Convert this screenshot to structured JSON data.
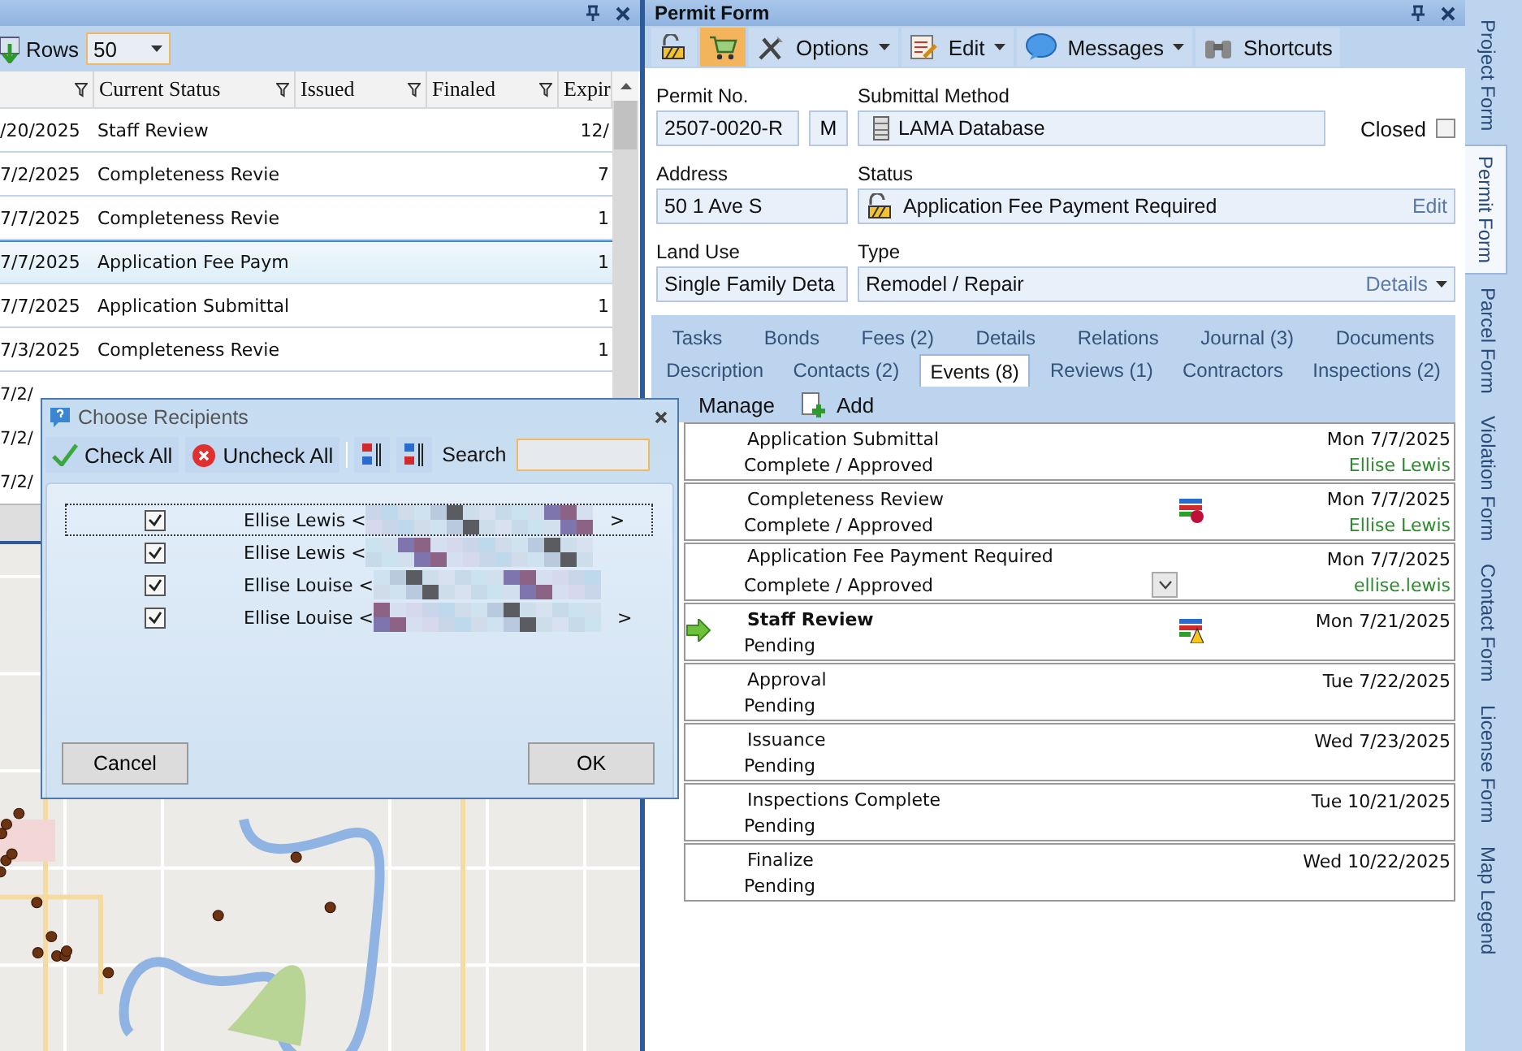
{
  "list_panel": {
    "rows_label": "Rows",
    "rows_value": "50",
    "columns": [
      "",
      "Current Status",
      "Issued",
      "Finaled",
      "Expir"
    ],
    "rows": [
      {
        "cells": [
          "/20/2025",
          "Staff Review",
          "",
          "",
          "12/"
        ],
        "selected": false
      },
      {
        "cells": [
          "7/2/2025",
          "Completeness Revie",
          "",
          "",
          "7"
        ],
        "selected": false
      },
      {
        "cells": [
          "7/7/2025",
          "Completeness Revie",
          "",
          "",
          "1"
        ],
        "selected": false
      },
      {
        "cells": [
          "7/7/2025",
          "Application Fee Paym",
          "",
          "",
          "1"
        ],
        "selected": true
      },
      {
        "cells": [
          "7/7/2025",
          "Application Submittal",
          "",
          "",
          "1"
        ],
        "selected": false
      },
      {
        "cells": [
          "7/3/2025",
          "Completeness Revie",
          "",
          "",
          "1"
        ],
        "selected": false
      }
    ],
    "covered_rows": [
      "7/2/",
      "7/2/",
      "7/2/"
    ]
  },
  "dialog": {
    "title": "Choose Recipients",
    "check_all": "Check All",
    "uncheck_all": "Uncheck All",
    "search_label": "Search",
    "recipients": [
      {
        "label": "Ellise Lewis <",
        "tail": ">",
        "checked": true,
        "focused": true
      },
      {
        "label": "Ellise Lewis <",
        "checked": true,
        "focused": false
      },
      {
        "label": "Ellise Louise <",
        "checked": true,
        "focused": false
      },
      {
        "label": "Ellise Louise <",
        "tail": ">",
        "checked": true,
        "focused": false
      }
    ],
    "buttons": [
      "Cancel",
      "OK"
    ]
  },
  "permit_form": {
    "title": "Permit Form",
    "toolbar": [
      {
        "kind": "lock",
        "selected": false
      },
      {
        "kind": "cart",
        "selected": true
      },
      {
        "kind": "menu",
        "label": "Options",
        "selected": false
      },
      {
        "kind": "menu",
        "label": "Edit",
        "selected": false
      },
      {
        "kind": "menu",
        "label": "Messages",
        "selected": false
      },
      {
        "kind": "button",
        "label": "Shortcuts",
        "selected": false
      }
    ],
    "permit_no": {
      "label": "Permit No.",
      "value": "2507-0020-R",
      "button": "M"
    },
    "submittal_method": {
      "label": "Submittal Method",
      "value": "LAMA Database"
    },
    "closed": {
      "label": "Closed",
      "checked": false
    },
    "address": {
      "label": "Address",
      "value": "50 1 Ave S"
    },
    "status": {
      "label": "Status",
      "value": "Application Fee Payment Required",
      "link": "Edit"
    },
    "land_use": {
      "label": "Land Use",
      "value": "Single Family Deta"
    },
    "type": {
      "label": "Type",
      "value": "Remodel / Repair",
      "link": "Details"
    },
    "tab_rows": [
      [
        {
          "label": "Tasks",
          "selected": false
        },
        {
          "label": "Bonds",
          "selected": false
        },
        {
          "label": "Fees (2)",
          "selected": false
        },
        {
          "label": "Details",
          "selected": false
        },
        {
          "label": "Relations",
          "selected": false
        },
        {
          "label": "Journal (3)",
          "selected": false
        },
        {
          "label": "Documents",
          "selected": false
        }
      ],
      [
        {
          "label": "Description",
          "selected": false
        },
        {
          "label": "Contacts (2)",
          "selected": false
        },
        {
          "label": "Events (8)",
          "selected": true
        },
        {
          "label": "Reviews (1)",
          "selected": false
        },
        {
          "label": "Contractors",
          "selected": false
        },
        {
          "label": "Inspections (2)",
          "selected": false
        }
      ]
    ],
    "event_actions": [
      "Manage",
      "Add"
    ],
    "events": [
      {
        "name": "Application Submittal",
        "status": "Complete / Approved",
        "date": "Mon 7/7/2025",
        "person": "Ellise Lewis",
        "current": false,
        "kind": "plain",
        "expandable": false
      },
      {
        "name": "Completeness Review",
        "status": "Complete / Approved",
        "date": "Mon 7/7/2025",
        "person": "Ellise Lewis",
        "current": false,
        "kind": "reviewed",
        "expandable": false
      },
      {
        "name": "Application Fee Payment Required",
        "status": "Complete / Approved",
        "date": "Mon 7/7/2025",
        "person": "ellise.lewis",
        "current": false,
        "kind": "plain",
        "expandable": true
      },
      {
        "name": "Staff Review",
        "status": "Pending",
        "date": "Mon 7/21/2025",
        "current": true,
        "kind": "review",
        "expandable": false
      },
      {
        "name": "Approval",
        "status": "Pending",
        "date": "Tue 7/22/2025",
        "current": false,
        "kind": "plain",
        "expandable": false
      },
      {
        "name": "Issuance",
        "status": "Pending",
        "date": "Wed 7/23/2025",
        "current": false,
        "kind": "plain",
        "expandable": false
      },
      {
        "name": "Inspections Complete",
        "status": "Pending",
        "date": "Tue 10/21/2025",
        "current": false,
        "kind": "plain",
        "expandable": false
      },
      {
        "name": "Finalize",
        "status": "Pending",
        "date": "Wed 10/22/2025",
        "current": false,
        "kind": "plain",
        "expandable": false
      }
    ]
  },
  "side_tabs": [
    {
      "label": "Project Form",
      "selected": false
    },
    {
      "label": "Permit Form",
      "selected": true
    },
    {
      "label": "Parcel Form",
      "selected": false
    },
    {
      "label": "Violation Form",
      "selected": false
    },
    {
      "label": "Contact Form",
      "selected": false
    },
    {
      "label": "License Form",
      "selected": false
    },
    {
      "label": "Map Legend",
      "selected": false
    }
  ]
}
